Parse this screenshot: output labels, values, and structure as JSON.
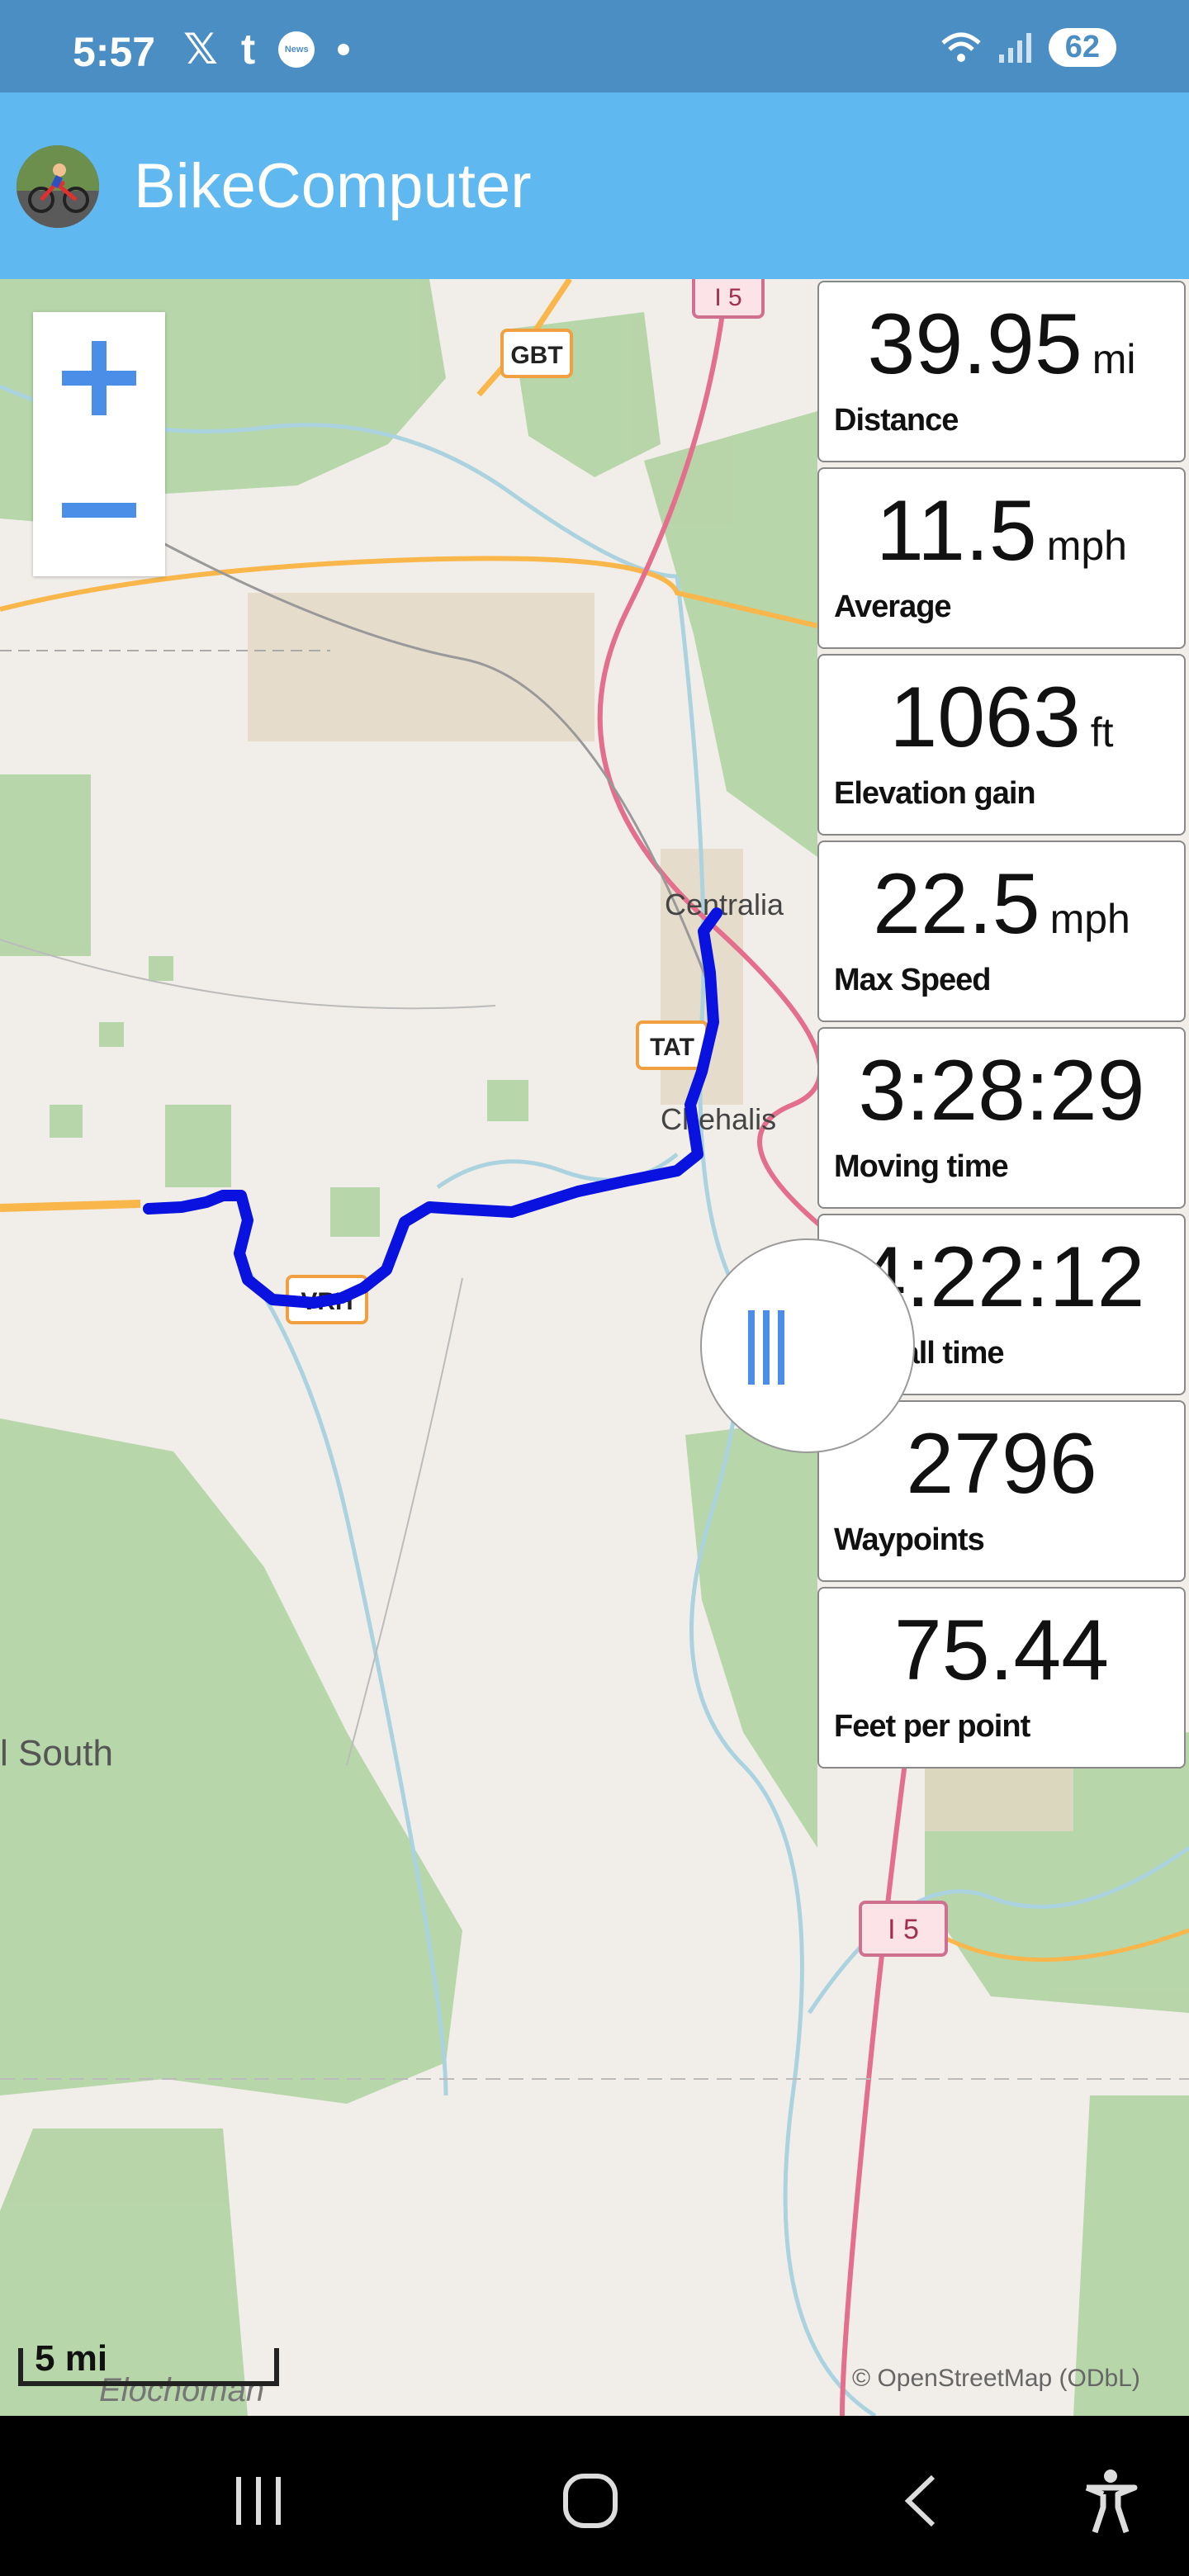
{
  "status_bar": {
    "time": "5:57",
    "icons_left": [
      "x-icon",
      "tumblr-icon",
      "news-icon",
      "dot-icon"
    ],
    "news_badge": "News",
    "battery": "62",
    "icons_right": [
      "wifi-icon",
      "signal-icon",
      "battery-icon"
    ]
  },
  "app_bar": {
    "title": "BikeComputer",
    "logo_icon": "bike-logo-icon"
  },
  "map": {
    "labels": {
      "centralia": "Centralia",
      "chehalis": "Chehalis",
      "south": "l South",
      "elochoman": "Elochoman"
    },
    "shields": {
      "gbt": "GBT",
      "tat": "TAT",
      "vrh": "VRH",
      "i5_top": "I 5",
      "i5_bottom": "I 5"
    },
    "scale_label": "5 mi",
    "attribution": "© OpenStreetMap (ODbL)",
    "route_color": "#0a12e0"
  },
  "zoom": {
    "in_icon": "plus-icon",
    "out_icon": "minus-icon"
  },
  "stats": [
    {
      "value": "39.95",
      "unit": "mi",
      "label": "Distance"
    },
    {
      "value": "11.5",
      "unit": "mph",
      "label": "Average"
    },
    {
      "value": "1063",
      "unit": "ft",
      "label": "Elevation gain"
    },
    {
      "value": "22.5",
      "unit": "mph",
      "label": "Max Speed"
    },
    {
      "value": "3:28:29",
      "unit": "",
      "label": "Moving time"
    },
    {
      "value": "4:22:12",
      "unit": "",
      "label": "Overall time"
    },
    {
      "value": "2796",
      "unit": "",
      "label": "Waypoints"
    },
    {
      "value": "75.44",
      "unit": "",
      "label": "Feet per point"
    }
  ],
  "nav_bar": {
    "buttons": [
      "recents-icon",
      "home-icon",
      "back-icon",
      "accessibility-icon"
    ]
  }
}
